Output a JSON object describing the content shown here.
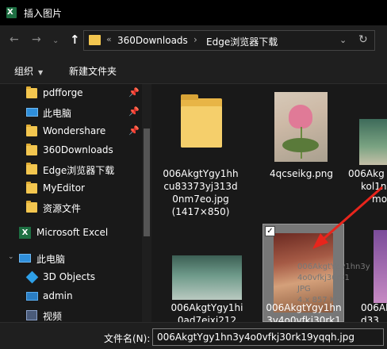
{
  "window": {
    "title": "插入图片"
  },
  "address": {
    "prefix": "«",
    "segments": [
      "360Downloads",
      "Edge浏览器下载"
    ],
    "separator": "›"
  },
  "toolbar": {
    "organize": "组织",
    "new_folder": "新建文件夹"
  },
  "nav": [
    {
      "label": "pdfforge",
      "icon": "folder-icon",
      "pinned": true
    },
    {
      "label": "此电脑",
      "icon": "pc-icon",
      "pinned": true
    },
    {
      "label": "Wondershare",
      "icon": "folder-icon",
      "pinned": true
    },
    {
      "label": "360Downloads",
      "icon": "folder-icon",
      "pinned": false
    },
    {
      "label": "Edge浏览器下载",
      "icon": "folder-icon",
      "pinned": false
    },
    {
      "label": "MyEditor",
      "icon": "folder-icon",
      "pinned": false
    },
    {
      "label": "资源文件",
      "icon": "folder-icon",
      "pinned": false
    },
    {
      "label": "Microsoft Excel",
      "icon": "excel-icon",
      "pinned": false
    },
    {
      "label": "此电脑",
      "icon": "pc-icon",
      "pinned": false
    },
    {
      "label": "3D Objects",
      "icon": "cube-icon",
      "pinned": false
    },
    {
      "label": "admin",
      "icon": "monitor-icon",
      "pinned": false
    },
    {
      "label": "视频",
      "icon": "video-icon",
      "pinned": false
    }
  ],
  "files": [
    {
      "caption": [
        "006AkgtYgy1hh",
        "cu83373yj313d",
        "0nm7eo.jpg",
        "(1417×850)"
      ]
    },
    {
      "caption": [
        "4qcseikg.png"
      ]
    },
    {
      "caption": [
        "006Akg",
        "kol1n",
        "mo"
      ]
    },
    {
      "caption": [
        "006AkgtYgy1hi",
        "0ad7ejxi212"
      ]
    },
    {
      "caption": [
        "006AkgtYgy1hn",
        "3y4o0vfkj30rk1"
      ]
    },
    {
      "caption": [
        "006Akg",
        "d33"
      ]
    }
  ],
  "ghost_overlay": [
    "006AkgtYgy1hn3y",
    "4o0vfkj30rk1",
    "JPG",
    "4.x 857 KB"
  ],
  "bottom": {
    "filename_label": "文件名(N):",
    "filename_value": "006AkgtYgy1hn3y4o0vfkj30rk19yqqh.jpg"
  },
  "icons": {
    "pin": "pin-icon",
    "back": "back-arrow-icon",
    "forward": "forward-arrow-icon",
    "up": "up-arrow-icon",
    "refresh": "refresh-icon",
    "dropdown": "chevron-down-icon"
  }
}
